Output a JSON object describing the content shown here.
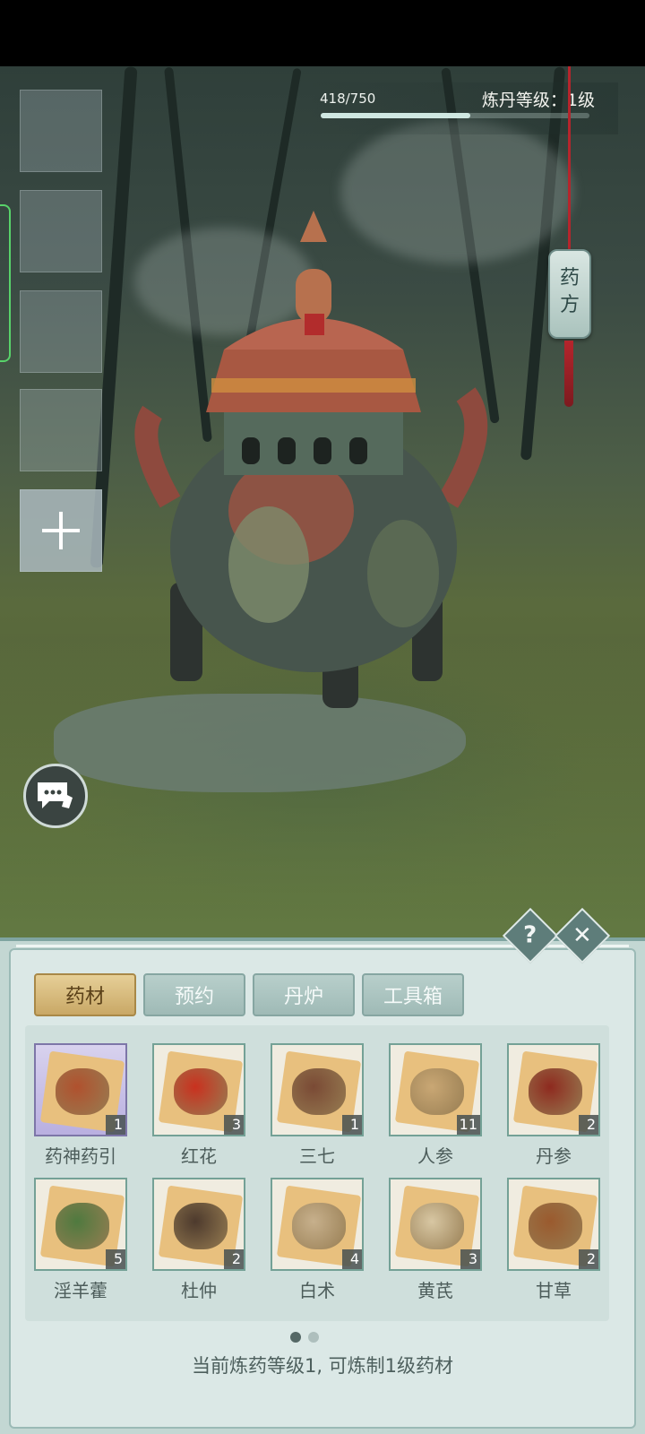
{
  "progress": {
    "text": "418/750",
    "current": 418,
    "max": 750,
    "fraction": 0.557
  },
  "level_label": "炼丹等级：1级",
  "recipe_button": {
    "label": "药方"
  },
  "tabs": [
    {
      "label": "药材",
      "active": true
    },
    {
      "label": "预约",
      "active": false
    },
    {
      "label": "丹炉",
      "active": false
    },
    {
      "label": "工具箱",
      "active": false
    }
  ],
  "items": [
    {
      "name": "药神药引",
      "count": "1",
      "icon": "herb-bundle-icon",
      "color": "#b0512e",
      "special": true
    },
    {
      "name": "红花",
      "count": "3",
      "icon": "safflower-icon",
      "color": "#c9311f"
    },
    {
      "name": "三七",
      "count": "1",
      "icon": "notoginseng-icon",
      "color": "#7a4a35"
    },
    {
      "name": "人参",
      "count": "11",
      "icon": "ginseng-icon",
      "color": "#c9a774"
    },
    {
      "name": "丹参",
      "count": "2",
      "icon": "salvia-root-icon",
      "color": "#8e2a1f"
    },
    {
      "name": "淫羊藿",
      "count": "5",
      "icon": "epimedium-leaf-icon",
      "color": "#4f7a3f"
    },
    {
      "name": "杜仲",
      "count": "2",
      "icon": "eucommia-bark-icon",
      "color": "#4d3a2d"
    },
    {
      "name": "白术",
      "count": "4",
      "icon": "atractylodes-icon",
      "color": "#c7b08c"
    },
    {
      "name": "黄芪",
      "count": "3",
      "icon": "astragalus-slices-icon",
      "color": "#d8c7a3"
    },
    {
      "name": "甘草",
      "count": "2",
      "icon": "licorice-slices-icon",
      "color": "#9a5a2e"
    }
  ],
  "help_label": "?",
  "close_label": "✕",
  "pager": {
    "pages": 2,
    "current": 1
  },
  "footer_text": "当前炼药等级1, 可炼制1级药材"
}
